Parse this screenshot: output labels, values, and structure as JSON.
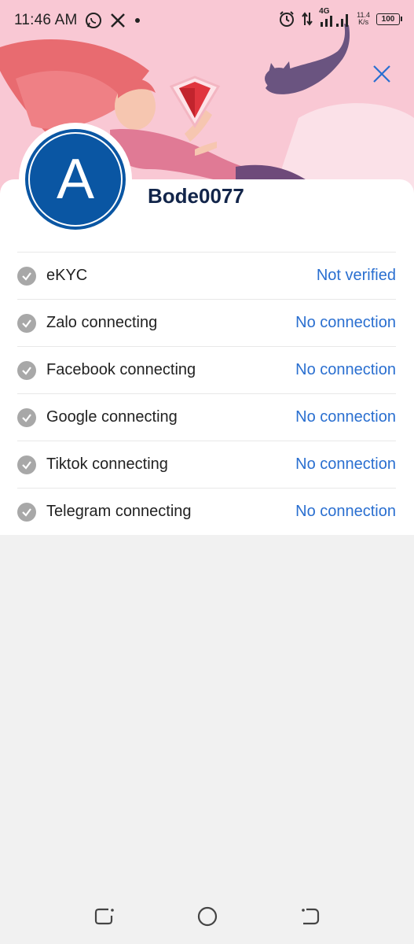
{
  "status_bar": {
    "time": "11:46 AM",
    "network_type": "4G",
    "speed_value": "11.4",
    "speed_unit": "K/s",
    "battery": "100"
  },
  "profile": {
    "avatar_letter": "A",
    "username": "Bode0077"
  },
  "connections": [
    {
      "label": "eKYC",
      "status": "Not verified"
    },
    {
      "label": "Zalo connecting",
      "status": "No connection"
    },
    {
      "label": "Facebook connecting",
      "status": "No connection"
    },
    {
      "label": "Google connecting",
      "status": "No connection"
    },
    {
      "label": "Tiktok connecting",
      "status": "No connection"
    },
    {
      "label": "Telegram connecting",
      "status": "No connection"
    }
  ],
  "colors": {
    "header_pink": "#f9c8d4",
    "avatar_blue": "#0a56a3",
    "username": "#12254a",
    "link_blue": "#2a6fd0",
    "check_gray": "#a8a8a8",
    "background": "#f1f1f1"
  },
  "icons": {
    "close": "close-icon",
    "check": "check-circle-icon",
    "nav_recent": "recent-apps-icon",
    "nav_home": "home-icon",
    "nav_back": "back-icon"
  }
}
